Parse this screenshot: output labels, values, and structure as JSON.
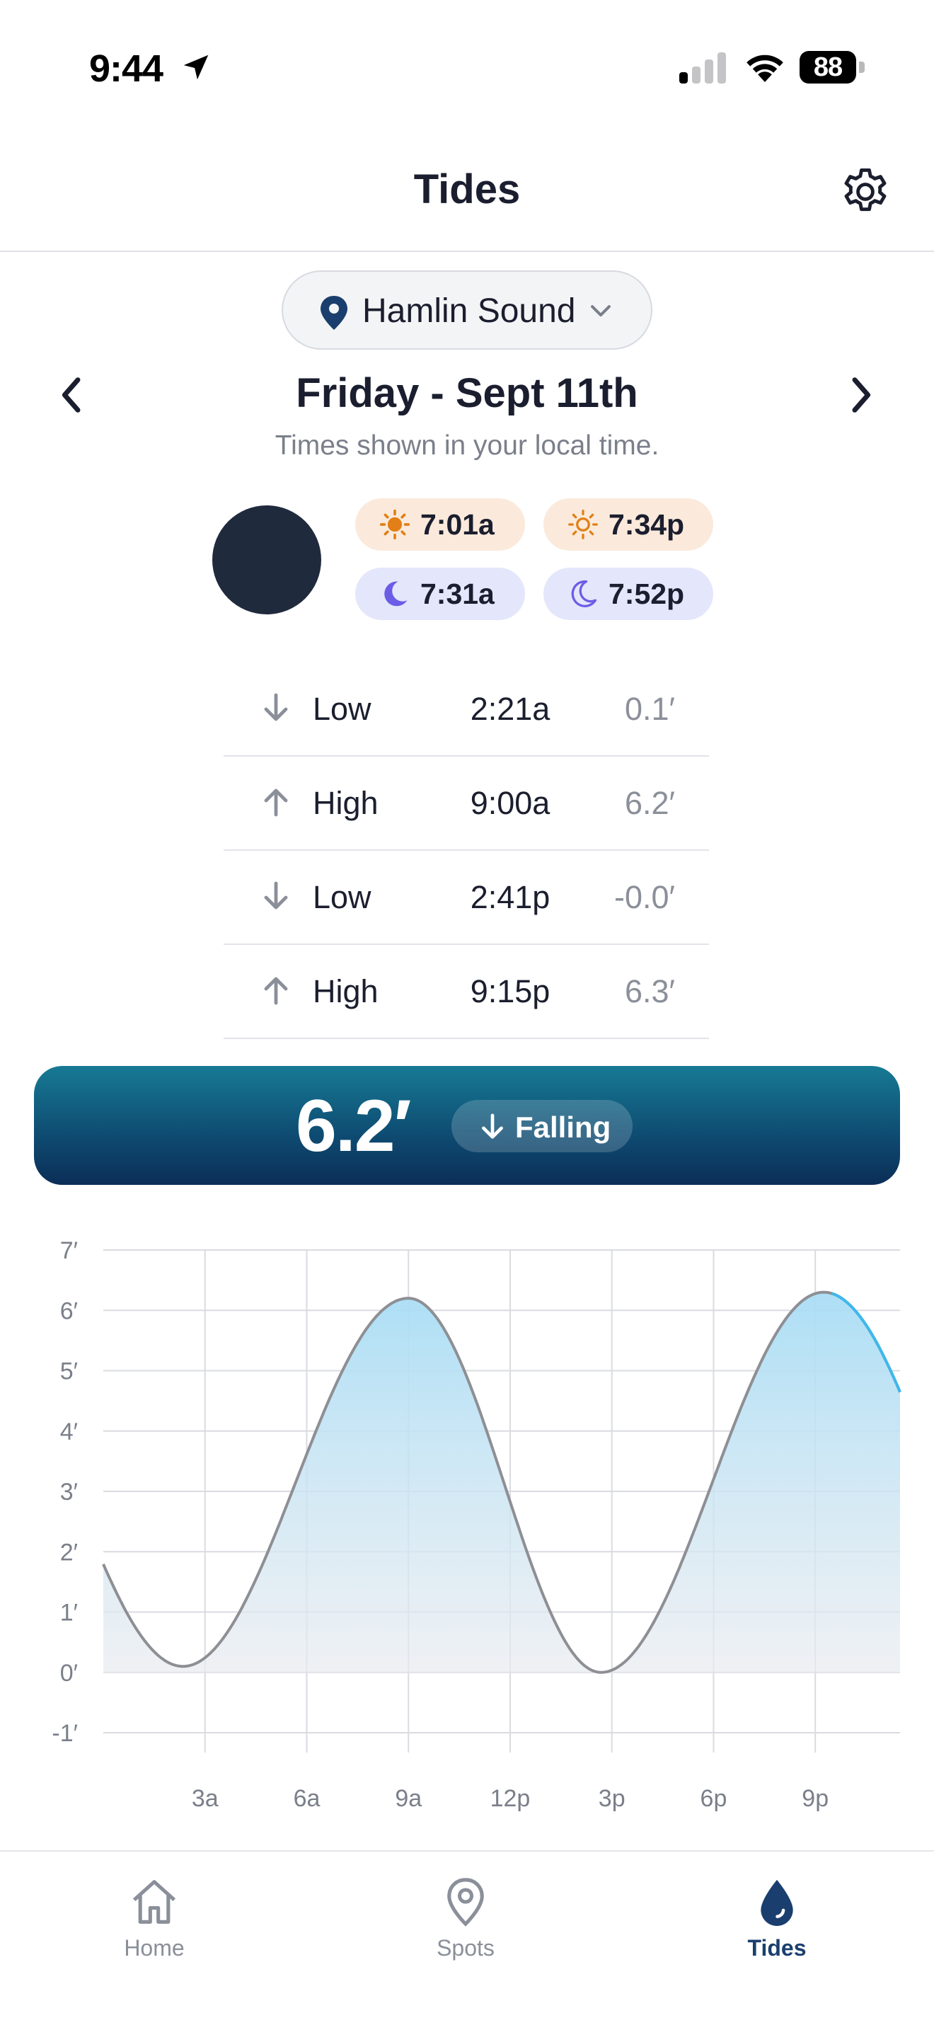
{
  "status_bar": {
    "time": "9:44",
    "battery": "88",
    "icons": [
      "location-arrow-icon",
      "cellular-signal-icon",
      "wifi-icon",
      "battery-icon"
    ]
  },
  "header": {
    "title": "Tides",
    "settings_icon": "gear-icon"
  },
  "location": {
    "name": "Hamlin Sound",
    "icon": "map-pin-icon"
  },
  "date_nav": {
    "title": "Friday - Sept 11th",
    "subtitle": "Times shown in your local time."
  },
  "sun_moon": [
    {
      "kind": "sunrise",
      "time": "7:01a",
      "icon": "sun-filled-icon"
    },
    {
      "kind": "sunset",
      "time": "7:34p",
      "icon": "sun-outline-icon"
    },
    {
      "kind": "moonrise",
      "time": "7:31a",
      "icon": "moon-filled-icon"
    },
    {
      "kind": "moonset",
      "time": "7:52p",
      "icon": "moon-outline-icon"
    }
  ],
  "tides": [
    {
      "direction": "down",
      "type": "Low",
      "time": "2:21a",
      "height": "0.1′"
    },
    {
      "direction": "up",
      "type": "High",
      "time": "9:00a",
      "height": "6.2′"
    },
    {
      "direction": "down",
      "type": "Low",
      "time": "2:41p",
      "height": "-0.0′"
    },
    {
      "direction": "up",
      "type": "High",
      "time": "9:15p",
      "height": "6.3′"
    }
  ],
  "current": {
    "value": "6.2′",
    "status": "Falling"
  },
  "colors": {
    "banner_top": "#177a94",
    "banner_bottom": "#0b2e57",
    "curve": "#8e8f94",
    "curve_future": "#3db8ec",
    "fill_top": "#a9ddf5",
    "tab_active": "#1a3f6e"
  },
  "chart_data": {
    "type": "area",
    "y_ticks": [
      "7′",
      "6′",
      "5′",
      "4′",
      "3′",
      "2′",
      "1′",
      "0′",
      "-1′"
    ],
    "x_ticks": [
      "3a",
      "6a",
      "9a",
      "12p",
      "3p",
      "6p",
      "9p"
    ],
    "ylim": [
      -1,
      7
    ],
    "xlim_hours": [
      0,
      23.5
    ],
    "current_hour": 21.5,
    "grid": true,
    "extremes": [
      {
        "hour": 2.35,
        "height": 0.1
      },
      {
        "hour": 9.0,
        "height": 6.2
      },
      {
        "hour": 14.68,
        "height": 0.0
      },
      {
        "hour": 21.25,
        "height": 6.3
      }
    ]
  },
  "tab_bar": {
    "items": [
      {
        "label": "Home",
        "icon": "home-icon",
        "active": false
      },
      {
        "label": "Spots",
        "icon": "map-pin-icon",
        "active": false
      },
      {
        "label": "Tides",
        "icon": "water-drop-icon",
        "active": true
      }
    ]
  }
}
